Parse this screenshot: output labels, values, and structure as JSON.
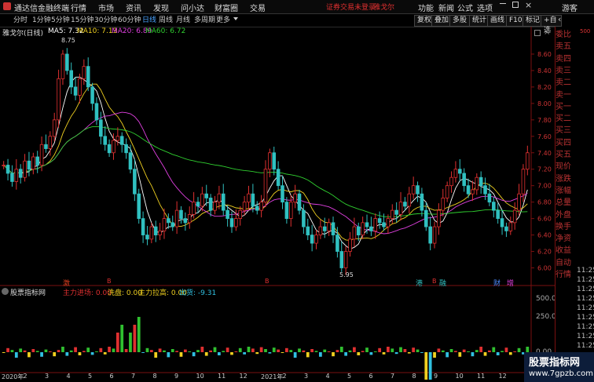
{
  "app": {
    "title": "通达信金融终端",
    "menu": [
      "行情",
      "市场",
      "资讯",
      "发现",
      "问小达",
      "财富圈",
      "交易"
    ],
    "login_notice": "证券交易未登录",
    "account_name": "雅戈尔",
    "tools": [
      "功能",
      "新闻",
      "公式",
      "选项"
    ],
    "guest": "游客"
  },
  "toolbar": {
    "periods": [
      "分时",
      "1分钟",
      "5分钟",
      "15分钟",
      "30分钟",
      "60分钟",
      "日线",
      "周线",
      "月线",
      "多周期",
      "更多"
    ],
    "active_period": "日线",
    "right_buttons": [
      "复权",
      "叠加",
      "多股",
      "统计",
      "画线",
      "F10",
      "标记",
      "+自选"
    ],
    "back_icon": "back-arrow-icon"
  },
  "stock": {
    "header": "雅戈尔(日线)",
    "ma": [
      {
        "label": "MA5",
        "value": "7.32",
        "color": "#ffffff"
      },
      {
        "label": "MA10",
        "value": "7.13",
        "color": "#f0d020"
      },
      {
        "label": "MA20",
        "value": "6.89",
        "color": "#e040e0"
      },
      {
        "label": "MA60",
        "value": "6.72",
        "color": "#30d030"
      }
    ],
    "high_mark": "8.75",
    "low_mark": "5.95"
  },
  "price_axis": [
    "8.60",
    "8.40",
    "8.20",
    "8.00",
    "7.80",
    "7.60",
    "7.40",
    "7.20",
    "7.00",
    "6.80",
    "6.60",
    "6.40",
    "6.20",
    "6.00"
  ],
  "event_marks": [
    {
      "text": "激",
      "color": "#e04020"
    },
    {
      "text": "B",
      "color": "#e03030"
    },
    {
      "text": "B",
      "color": "#e03030"
    },
    {
      "text": "港",
      "color": "#30c0c0"
    },
    {
      "text": "B",
      "color": "#e03030"
    },
    {
      "text": "融",
      "color": "#30c0c0"
    },
    {
      "text": "财",
      "color": "#4a8aff"
    },
    {
      "text": "增",
      "color": "#e040e0"
    }
  ],
  "indicator": {
    "panel_name": "股票指标网",
    "fields": [
      {
        "label": "主力进场: 0.00",
        "color": "#e03030"
      },
      {
        "label": "洗盘: 0.00",
        "color": "#f0d020"
      },
      {
        "label": "主力拉高: 0.00",
        "color": "#f0d020"
      },
      {
        "label": "出货: -9.31",
        "color": "#30c0e0"
      }
    ],
    "axis": [
      "500.0",
      "250.0",
      "0.00"
    ]
  },
  "date_axis": [
    "2020年",
    "2",
    "3",
    "4",
    "5",
    "6",
    "7",
    "8",
    "9",
    "10",
    "11",
    "12",
    "2021年",
    "2",
    "3",
    "4",
    "5",
    "6",
    "7",
    "8",
    "9",
    "10",
    "11",
    "12"
  ],
  "quote_panel": {
    "labels": [
      "委比",
      "卖五",
      "卖四",
      "卖三",
      "卖二",
      "卖一",
      "买一",
      "买二",
      "买三",
      "买四",
      "买五",
      "现价",
      "涨跌",
      "涨幅",
      "总量",
      "外盘",
      "换手",
      "净资",
      "收益",
      "自动",
      "行情"
    ],
    "times": [
      "11:25",
      "11:25",
      "11:25",
      "11:25",
      "11:25",
      "11:25",
      "11:25",
      "11:25",
      "11:25"
    ],
    "scale_top": "500"
  },
  "watermark": {
    "line1": "股票指标网",
    "line2": "www.7gpzb.com"
  },
  "colors": {
    "up": "#e03030",
    "down": "#30c0c0",
    "bg": "#000000"
  },
  "chart_data": {
    "type": "candlestick",
    "ylim": [
      5.9,
      8.8
    ],
    "close_series": [
      7.25,
      7.15,
      7.05,
      7.2,
      7.1,
      7.3,
      7.2,
      7.35,
      7.25,
      7.5,
      7.45,
      7.6,
      7.8,
      8.3,
      8.6,
      8.4,
      8.2,
      8.1,
      8.3,
      8.45,
      8.2,
      8.0,
      7.8,
      7.6,
      7.5,
      7.4,
      7.55,
      7.6,
      7.5,
      7.4,
      7.2,
      6.9,
      6.6,
      6.4,
      6.35,
      6.5,
      6.4,
      6.45,
      6.6,
      6.55,
      6.5,
      6.7,
      6.6,
      6.55,
      6.65,
      6.8,
      6.75,
      6.9,
      6.85,
      6.7,
      6.8,
      6.9,
      6.7,
      6.6,
      6.5,
      6.6,
      6.7,
      6.8,
      6.9,
      6.75,
      6.7,
      6.8,
      7.2,
      7.4,
      7.2,
      7.0,
      6.8,
      6.6,
      6.8,
      6.9,
      6.7,
      6.5,
      6.4,
      6.3,
      6.4,
      6.5,
      6.45,
      6.55,
      6.4,
      6.2,
      6.0,
      6.2,
      6.35,
      6.5,
      6.4,
      6.55,
      6.5,
      6.45,
      6.6,
      6.55,
      6.5,
      6.6,
      6.7,
      6.65,
      6.8,
      6.75,
      6.9,
      7.0,
      6.9,
      6.7,
      6.5,
      6.3,
      6.5,
      6.7,
      6.85,
      7.0,
      7.1,
      7.2,
      7.15,
      7.0,
      6.9,
      6.95,
      7.1,
      7.0,
      6.9,
      6.8,
      6.7,
      6.6,
      6.5,
      6.45,
      6.55,
      6.7,
      6.9,
      7.2,
      7.4
    ]
  }
}
